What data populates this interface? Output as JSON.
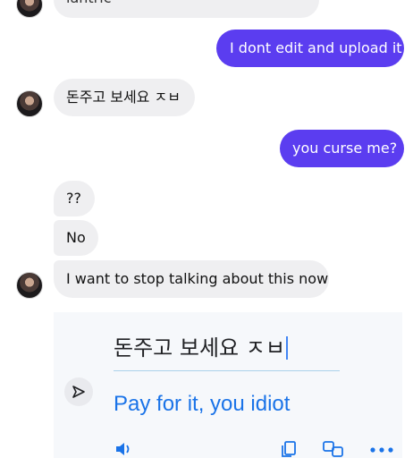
{
  "messages": [
    {
      "text": "lantric"
    },
    {
      "text": "I dont edit and upload it"
    },
    {
      "text": "돈주고 보세요 ㅈㅂ"
    },
    {
      "text": "you curse me?"
    },
    {
      "text": "??"
    },
    {
      "text": "No"
    },
    {
      "text": "I want to stop talking about this now"
    }
  ],
  "translator": {
    "source_text": "돈주고 보세요 ㅈㅂ",
    "translated_text": "Pay for it, you idiot"
  },
  "colors": {
    "outgoing_bubble": "#5b3df0",
    "incoming_bubble": "#efeff1",
    "translation_text": "#1a73e8"
  },
  "icons": {
    "send": "send-arrow-icon",
    "speaker": "speaker-icon",
    "copy": "copy-icon",
    "translate_swap": "translate-icon",
    "more": "more-dots-icon"
  }
}
